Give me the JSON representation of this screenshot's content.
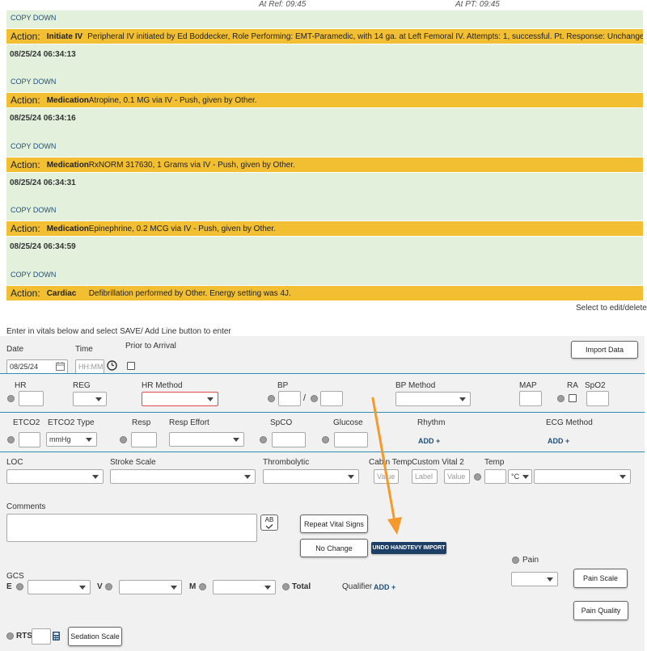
{
  "header": {
    "at_ref": "At Ref: 09:45",
    "at_pt": "At PT: 09:45"
  },
  "timeline": [
    {
      "timestamp": "",
      "copy_down": "COPY DOWN",
      "action_label": "Action:",
      "action_type": "Initiate IV",
      "action_text": "Peripheral IV initiated by Ed Boddecker, Role Performing: EMT-Paramedic, with 14 ga. at Left Femoral IV. Attempts: 1, successful. Pt. Response: Unchanged."
    },
    {
      "timestamp": "08/25/24 06:34:13",
      "copy_down": "COPY DOWN",
      "action_label": "Action:",
      "action_type": "Medication",
      "action_text": "Atropine, 0.1 MG via IV - Push, given by Other."
    },
    {
      "timestamp": "08/25/24 06:34:16",
      "copy_down": "COPY DOWN",
      "action_label": "Action:",
      "action_type": "Medication",
      "action_text": "RxNORM 317630, 1 Grams via IV - Push, given by Other."
    },
    {
      "timestamp": "08/25/24 06:34:31",
      "copy_down": "COPY DOWN",
      "action_label": "Action:",
      "action_type": "Medication",
      "action_text": "Epinephrine, 0.2 MCG via IV - Push, given by Other."
    },
    {
      "timestamp": "08/25/24 06:34:59",
      "copy_down": "COPY DOWN",
      "action_label": "Action:",
      "action_type": "Cardiac",
      "action_text": "Defibrillation performed by Other. Energy setting was 4J."
    }
  ],
  "select_edit": "Select to edit/delete",
  "instructions": "Enter in vitals below and select SAVE/ Add Line button to enter",
  "row_date": {
    "date_label": "Date",
    "date_value": "08/25/24",
    "time_label": "Time",
    "time_placeholder": "HH:MM",
    "prior_label": "Prior to Arrival",
    "import_button": "Import Data"
  },
  "row_vitals1": {
    "hr": "HR",
    "reg": "REG",
    "hr_method": "HR Method",
    "bp": "BP",
    "bp_sep": "/",
    "bp_method": "BP Method",
    "map": "MAP",
    "ra": "RA",
    "spo2": "SpO2"
  },
  "row_vitals2": {
    "etco2": "ETCO2",
    "etco2_type": "ETCO2 Type",
    "etco2_unit": "mmHg",
    "resp": "Resp",
    "resp_effort": "Resp Effort",
    "spco": "SpCO",
    "glucose": "Glucose",
    "rhythm": "Rhythm",
    "rhythm_add": "ADD +",
    "ecg_method": "ECG Method",
    "ecg_add": "ADD +"
  },
  "row_vitals3": {
    "loc": "LOC",
    "stroke": "Stroke Scale",
    "thrombolytic": "Thrombolytic",
    "cabin_temp": "Cabin Temp",
    "cabin_placeholder": "Value",
    "custom_vital": "Custom Vital 2",
    "custom_label_placeholder": "Label",
    "custom_value_placeholder": "Value",
    "temp": "Temp",
    "temp_unit": "°C"
  },
  "comments": {
    "label": "Comments",
    "spell_icon_text": "AB",
    "repeat_button": "Repeat Vital Signs",
    "no_change_button": "No Change",
    "undo_button": "UNDO HANDTEVY IMPORT"
  },
  "gcs": {
    "label": "GCS",
    "e": "E",
    "v": "V",
    "m": "M",
    "total": "Total",
    "qualifier": "Qualifier",
    "qualifier_add": "ADD +"
  },
  "pain": {
    "label": "Pain",
    "scale_button": "Pain Scale",
    "quality_button": "Pain Quality"
  },
  "rts": {
    "label": "RTS",
    "sedation_button": "Sedation Scale"
  },
  "colors": {
    "entry_bg": "#e3f1dc",
    "action_bg": "#f2bf33",
    "link": "#1f4f7a",
    "divider": "#2f8fb2",
    "arrow": "#f39a2a",
    "undo_bg": "#1d3f66"
  }
}
